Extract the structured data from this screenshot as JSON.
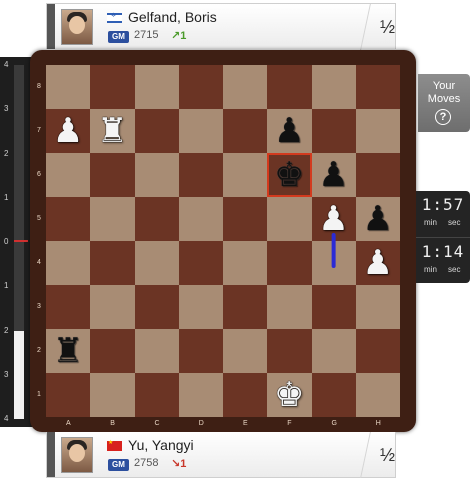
{
  "top_player": {
    "name": "Gelfand, Boris",
    "flag": "flag-israel",
    "title": "GM",
    "rating": "2715",
    "rating_change": "1",
    "rating_trend": "up",
    "score": "½"
  },
  "bottom_player": {
    "name": "Yu, Yangyi",
    "flag": "flag-china",
    "title": "GM",
    "rating": "2758",
    "rating_change": "1",
    "rating_trend": "down",
    "score": "½"
  },
  "eval_bar": {
    "ticks": [
      "4",
      "3",
      "2",
      "1",
      "0",
      "1",
      "2",
      "3",
      "4"
    ],
    "white_share": 0.25
  },
  "your_moves": {
    "line1": "Your",
    "line2": "Moves",
    "help_icon": "question-icon"
  },
  "clock": {
    "top": {
      "time": "1:57",
      "min": "min",
      "sec": "sec"
    },
    "bottom": {
      "time": "1:14",
      "min": "min",
      "sec": "sec"
    }
  },
  "board": {
    "files": [
      "A",
      "B",
      "C",
      "D",
      "E",
      "F",
      "G",
      "H"
    ],
    "ranks": [
      "8",
      "7",
      "6",
      "5",
      "4",
      "3",
      "2",
      "1"
    ],
    "highlight": "f6",
    "last_move": {
      "from": "g4",
      "to": "g5"
    },
    "pieces": [
      {
        "square": "a7",
        "color": "white",
        "type": "pawn",
        "glyph": "♟"
      },
      {
        "square": "b7",
        "color": "white",
        "type": "rook",
        "glyph": "♜"
      },
      {
        "square": "f7",
        "color": "black",
        "type": "pawn",
        "glyph": "♟"
      },
      {
        "square": "f6",
        "color": "black",
        "type": "king",
        "glyph": "♚"
      },
      {
        "square": "g6",
        "color": "black",
        "type": "pawn",
        "glyph": "♟"
      },
      {
        "square": "g5",
        "color": "white",
        "type": "pawn",
        "glyph": "♟"
      },
      {
        "square": "h5",
        "color": "black",
        "type": "pawn",
        "glyph": "♟"
      },
      {
        "square": "h4",
        "color": "white",
        "type": "pawn",
        "glyph": "♟"
      },
      {
        "square": "a2",
        "color": "black",
        "type": "rook",
        "glyph": "♜"
      },
      {
        "square": "f1",
        "color": "white",
        "type": "king",
        "glyph": "♚"
      }
    ]
  },
  "colors": {
    "light_square": "#a88c74",
    "dark_square": "#6b3424",
    "frame": "#3e1f14",
    "highlight": "#d33a1e",
    "move_arrow": "#2b2bd6"
  }
}
